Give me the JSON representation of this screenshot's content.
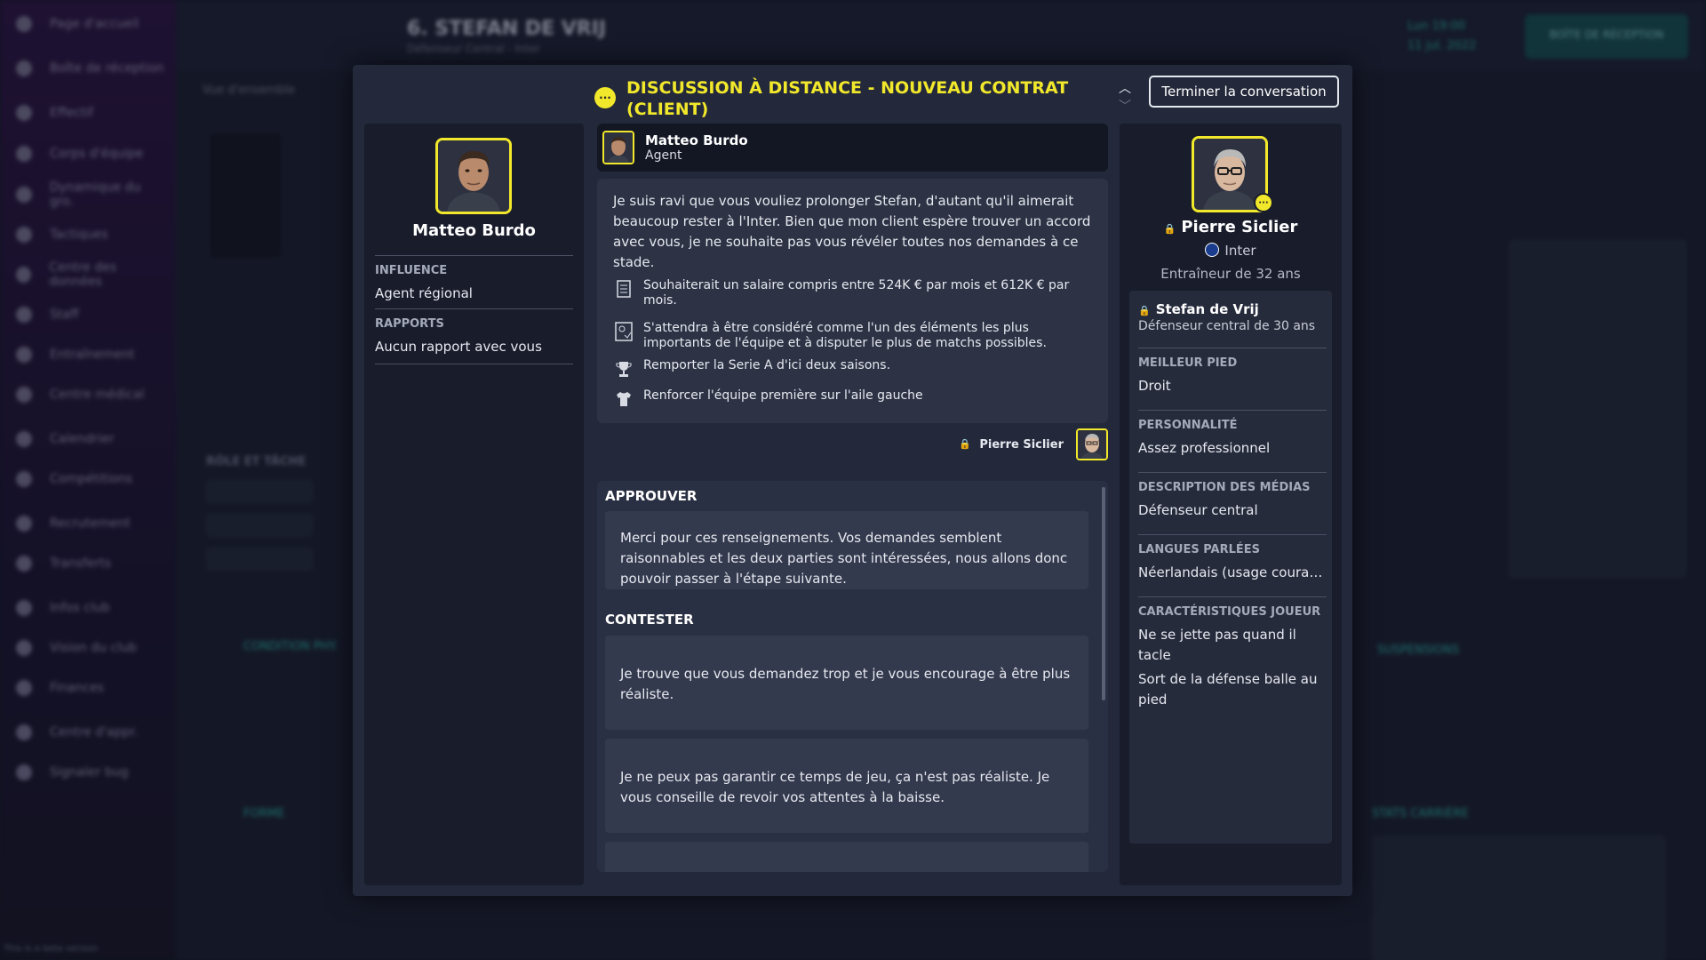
{
  "background": {
    "sidebar_items": [
      "Page d'accueil",
      "Boîte de réception",
      "Effectif",
      "Corps d'équipe",
      "Dynamique du gro.",
      "Tactiques",
      "Centre des données",
      "Staff",
      "Entraînement",
      "Centre médical",
      "Calendrier",
      "Compétitions",
      "Recrutement",
      "Transferts",
      "Infos club",
      "Vision du club",
      "Finances",
      "Centre d'appr.",
      "Signaler bug"
    ],
    "player_title": "6. STEFAN DE VRIJ",
    "player_subtitle": "Défenseur Central - Inter",
    "date_line1": "Lun 19:00",
    "date_line2": "11 jul. 2022",
    "inbox_label": "BOÎTE DE RÉCEPTION",
    "tab_label": "Vue d'ensemble",
    "role_heading": "RÔLE ET TÂCHE",
    "condition_heading": "CONDITION PHY.",
    "form_heading": "FORME",
    "suspensions_heading": "SUSPENSIONS",
    "career_heading": "STATS CARRIÈRE",
    "version_text": "This is a beta version"
  },
  "modal": {
    "title_icon": "chat-bubble-icon",
    "title": "DISCUSSION À DISTANCE - NOUVEAU CONTRAT (CLIENT)",
    "end_button": "Terminer la conversation"
  },
  "agent": {
    "name": "Matteo Burdo",
    "influence_label": "INFLUENCE",
    "influence_value": "Agent régional",
    "reports_label": "RAPPORTS",
    "reports_value": "Aucun rapport avec vous"
  },
  "message": {
    "sender_name": "Matteo Burdo",
    "sender_role": "Agent",
    "text": "Je suis ravi que vous vouliez prolonger Stefan, d'autant qu'il aimerait beaucoup rester à l'Inter. Bien que mon client espère trouver un accord avec vous, je ne souhaite pas vous révéler toutes nos demandes à ce stade.",
    "demands": [
      {
        "icon": "document-icon",
        "text": "Souhaiterait un salaire compris entre 524K € par mois et 612K € par mois."
      },
      {
        "icon": "squad-role-icon",
        "text": "S'attendra à être considéré comme l'un des éléments les plus importants de l'équipe et à disputer le plus de matchs possibles."
      },
      {
        "icon": "trophy-icon",
        "text": "Remporter la Serie A d'ici deux saisons."
      },
      {
        "icon": "shirt-icon",
        "text": "Renforcer l'équipe première sur l'aile gauche"
      }
    ]
  },
  "reply": {
    "sender_name": "Pierre Siclier"
  },
  "options": {
    "approve_heading": "APPROUVER",
    "approve_options": [
      "Merci pour ces renseignements. Vos demandes semblent raisonnables et les deux parties sont intéressées, nous allons donc pouvoir passer à l'étape suivante."
    ],
    "contest_heading": "CONTESTER",
    "contest_options": [
      "Je trouve que vous demandez trop et je vous encourage à être plus réaliste.",
      "Je ne peux pas garantir ce temps de jeu, ça n'est pas réaliste. Je vous conseille de revoir vos attentes à la baisse."
    ]
  },
  "manager": {
    "name": "Pierre Siclier",
    "club": "Inter",
    "description": "Entraîneur de 32 ans"
  },
  "player": {
    "name": "Stefan de Vrij",
    "role": "Défenseur central de 30 ans",
    "best_foot_label": "MEILLEUR PIED",
    "best_foot_value": "Droit",
    "personality_label": "PERSONNALITÉ",
    "personality_value": "Assez professionnel",
    "media_label": "DESCRIPTION DES MÉDIAS",
    "media_value": "Défenseur central",
    "languages_label": "LANGUES PARLÉES",
    "languages_value": "Néerlandais (usage coura....",
    "traits_label": "CARACTÉRISTIQUES JOUEUR",
    "traits": [
      "Ne se jette pas quand il tacle",
      "Sort de la défense balle au pied"
    ]
  },
  "colors": {
    "accent_yellow": "#f2e82b",
    "modal_bg": "#23293b",
    "panel_bg": "#181c2b"
  }
}
